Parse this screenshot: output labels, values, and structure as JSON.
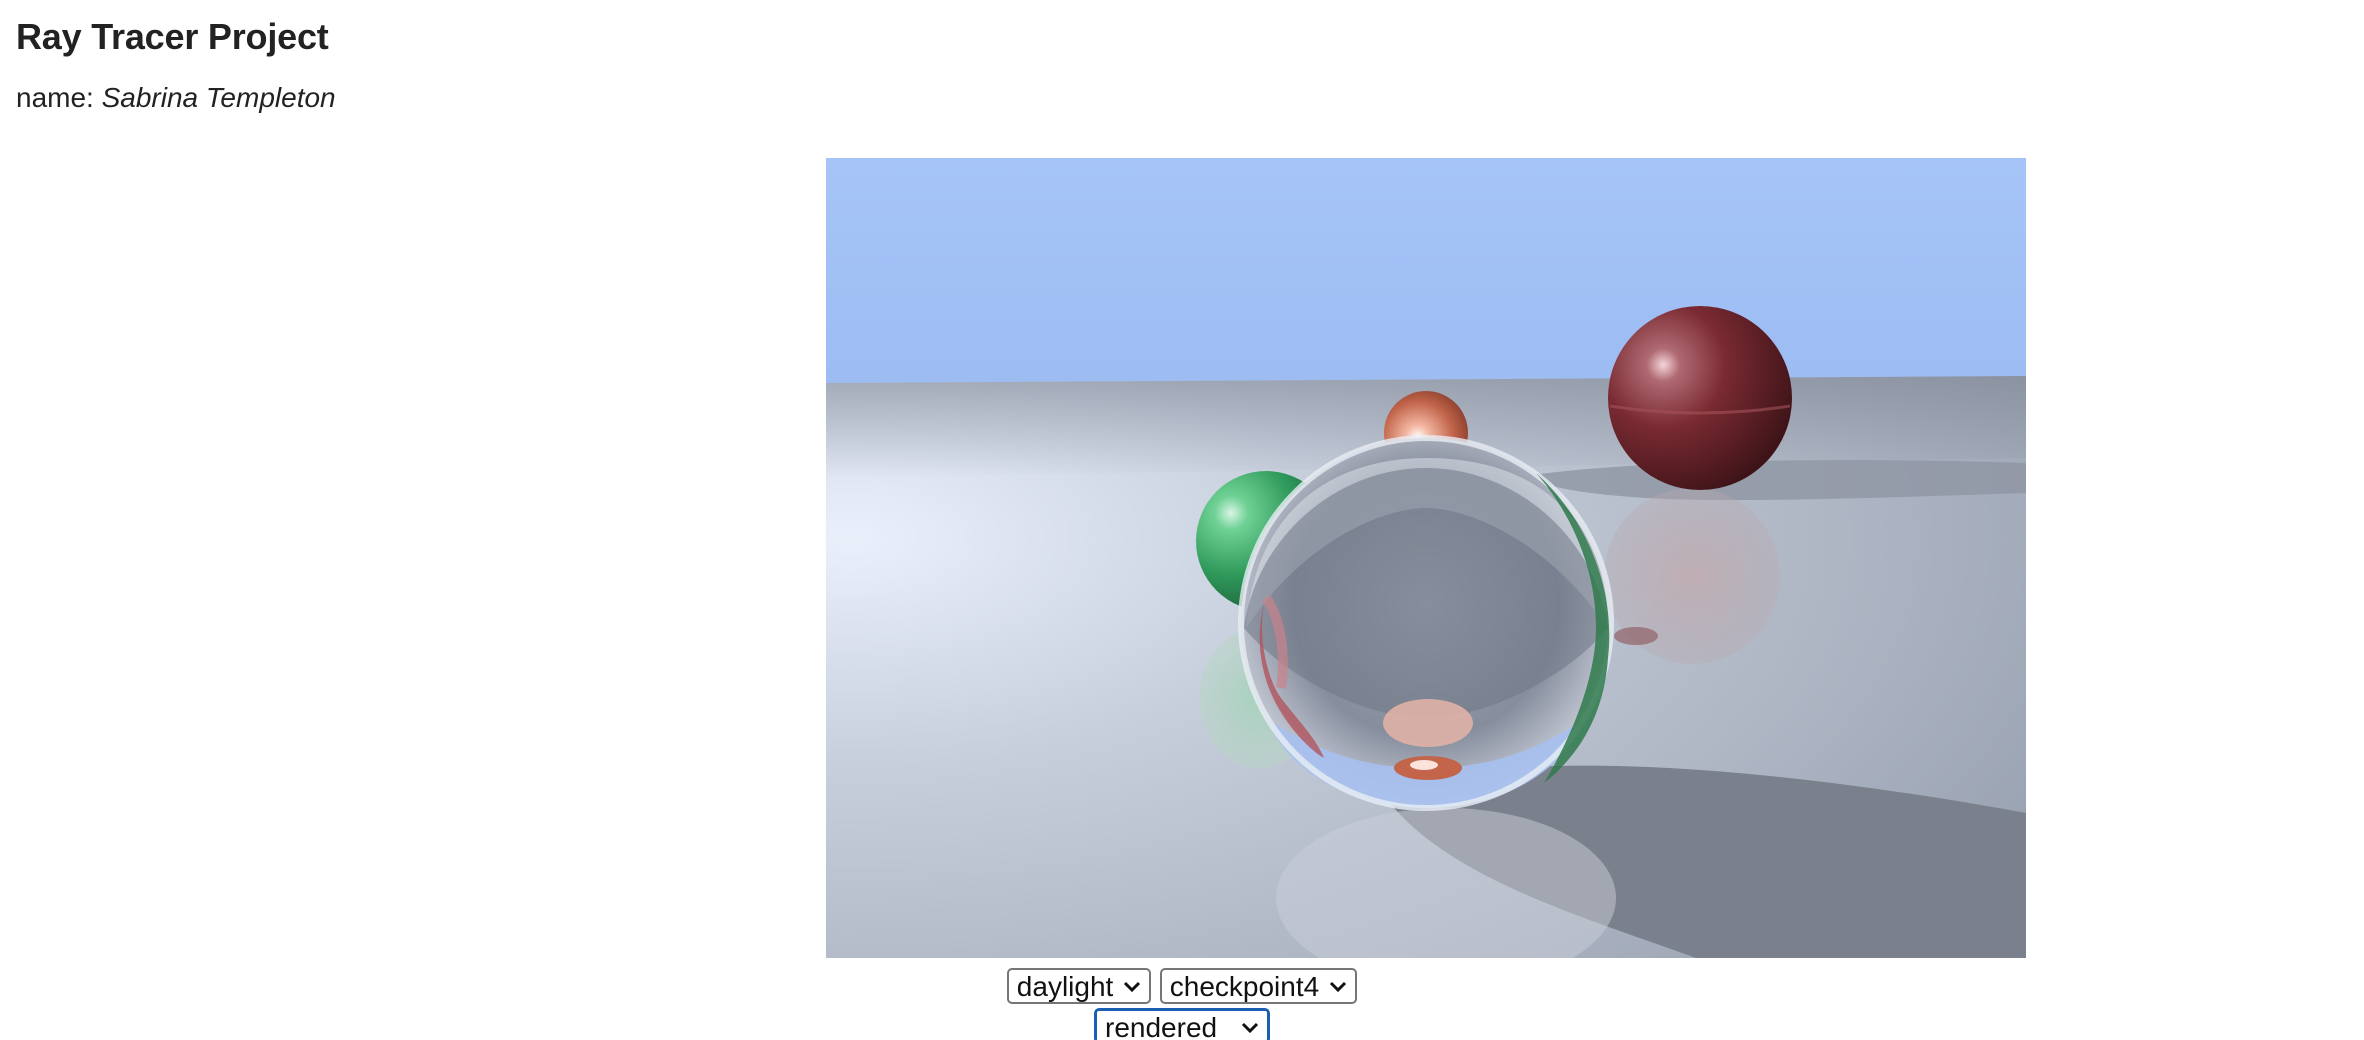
{
  "page": {
    "title": "Ray Tracer Project",
    "name_label": "name:",
    "name_value": "Sabrina Templeton"
  },
  "render": {
    "sky_color": "#a3c3f7",
    "floor_color": "#b6bdcb",
    "spheres": [
      "glass-sphere",
      "green-sphere",
      "copper-sphere",
      "red-sphere"
    ]
  },
  "controls": {
    "lighting": {
      "selected": "daylight"
    },
    "scene": {
      "selected": "checkpoint4"
    },
    "mode": {
      "selected": "rendered"
    }
  },
  "icons": {
    "dropdown": "chevron-down-icon"
  }
}
